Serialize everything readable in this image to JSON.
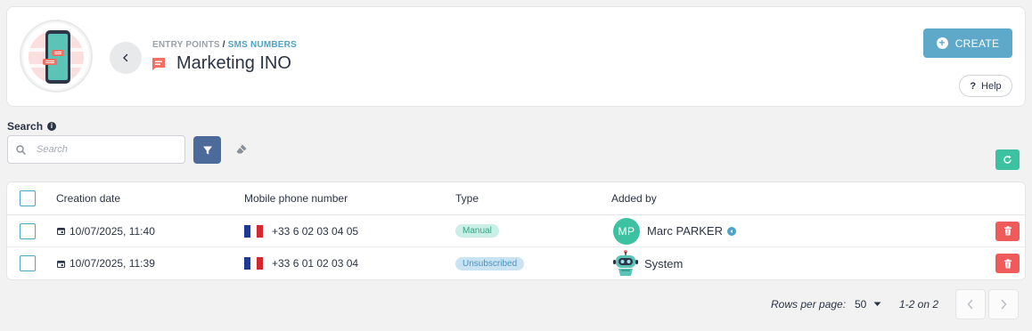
{
  "header": {
    "breadcrumb_root": "ENTRY POINTS",
    "breadcrumb_separator": "/",
    "breadcrumb_current": "SMS NUMBERS",
    "title": "Marketing INO",
    "create_label": "CREATE",
    "help_label": "Help",
    "help_glyph": "?"
  },
  "search": {
    "label": "Search",
    "info_glyph": "i",
    "value": "",
    "placeholder": "Search"
  },
  "table": {
    "columns": [
      "Creation date",
      "Mobile phone number",
      "Type",
      "Added by"
    ],
    "rows": [
      {
        "date": "10/07/2025, 11:40",
        "phone": "+33 6 02 03 04 05",
        "type": "Manual",
        "added_by_initials": "MP",
        "added_by": "Marc PARKER"
      },
      {
        "date": "10/07/2025, 11:39",
        "phone": "+33 6 01 02 03 04",
        "type": "Unsubscribed",
        "added_by": "System"
      }
    ]
  },
  "pagination": {
    "rows_per_page_label": "Rows per page:",
    "rows_per_page_value": "50",
    "range": "1-2 on 2"
  },
  "colors": {
    "accent": "#5ea9c9",
    "filter_button": "#4c6b9a",
    "success": "#3cc2a1",
    "danger": "#ef5b5b",
    "flag_blue": "#1f3a93",
    "flag_red": "#d8262e"
  },
  "icons": [
    "sms-icon",
    "chevron-left-icon",
    "plus-circle-icon",
    "search-icon",
    "filter-icon",
    "eraser-icon",
    "refresh-icon",
    "calendar-icon",
    "france-flag-icon",
    "verified-icon",
    "trash-icon",
    "robot-avatar-icon",
    "chevron-right-icon",
    "caret-down-icon"
  ]
}
